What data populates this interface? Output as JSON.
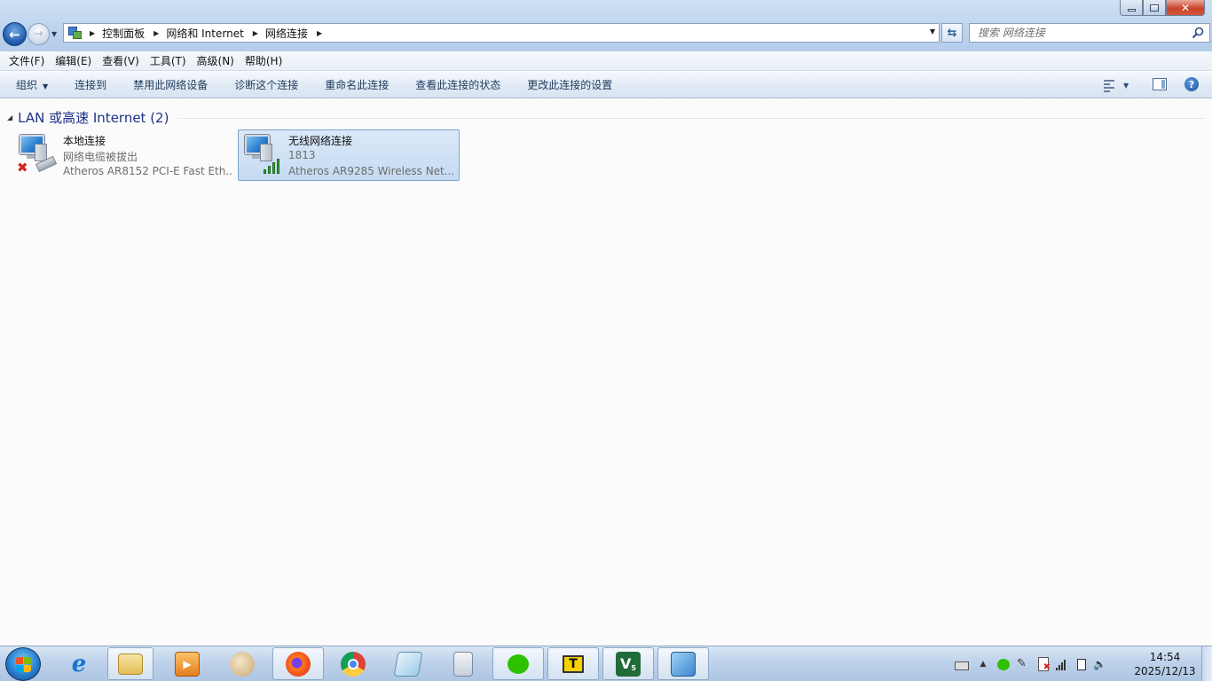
{
  "window": {
    "minimize_label": "",
    "maximize_label": "",
    "close_label": "✕"
  },
  "nav": {
    "back_glyph": "←",
    "forward_glyph": "→"
  },
  "address": {
    "breadcrumbs": [
      "控制面板",
      "网络和 Internet",
      "网络连接"
    ],
    "search_placeholder": "搜索 网络连接"
  },
  "menu": [
    "文件(F)",
    "编辑(E)",
    "查看(V)",
    "工具(T)",
    "高级(N)",
    "帮助(H)"
  ],
  "commands": {
    "organize": "组织",
    "connect": "连接到",
    "disable": "禁用此网络设备",
    "diagnose": "诊断这个连接",
    "rename": "重命名此连接",
    "status": "查看此连接的状态",
    "settings": "更改此连接的设置"
  },
  "group": {
    "title": "LAN 或高速 Internet (2)"
  },
  "connections": [
    {
      "name": "本地连接",
      "status": "网络电缆被拔出",
      "device": "Atheros AR8152 PCI-E Fast Eth...",
      "icon": "wired-disconnected-icon"
    },
    {
      "name": "无线网络连接",
      "status": "1813",
      "device": "Atheros AR9285 Wireless Net...",
      "icon": "wireless-connected-icon",
      "selected": true
    }
  ],
  "taskbar": {
    "apps": [
      "internet-explorer-icon",
      "file-explorer-icon",
      "media-player-icon",
      "paint-icon",
      "firefox-icon",
      "chrome-icon",
      "notepad-icon",
      "calculator-icon",
      "wechat-icon",
      "t-app-icon",
      "v5-app-icon",
      "network-connections-icon"
    ],
    "t_app_letter": "T",
    "v5_letter": "V",
    "v5_sub": "5",
    "help_glyph": "?"
  },
  "clock": {
    "time": "14:54",
    "date": "2025/12/13"
  },
  "colors": {
    "accent": "#1e3287",
    "selection": "#c5daf2",
    "signal": "#3aa23a",
    "error": "#d3261e"
  }
}
